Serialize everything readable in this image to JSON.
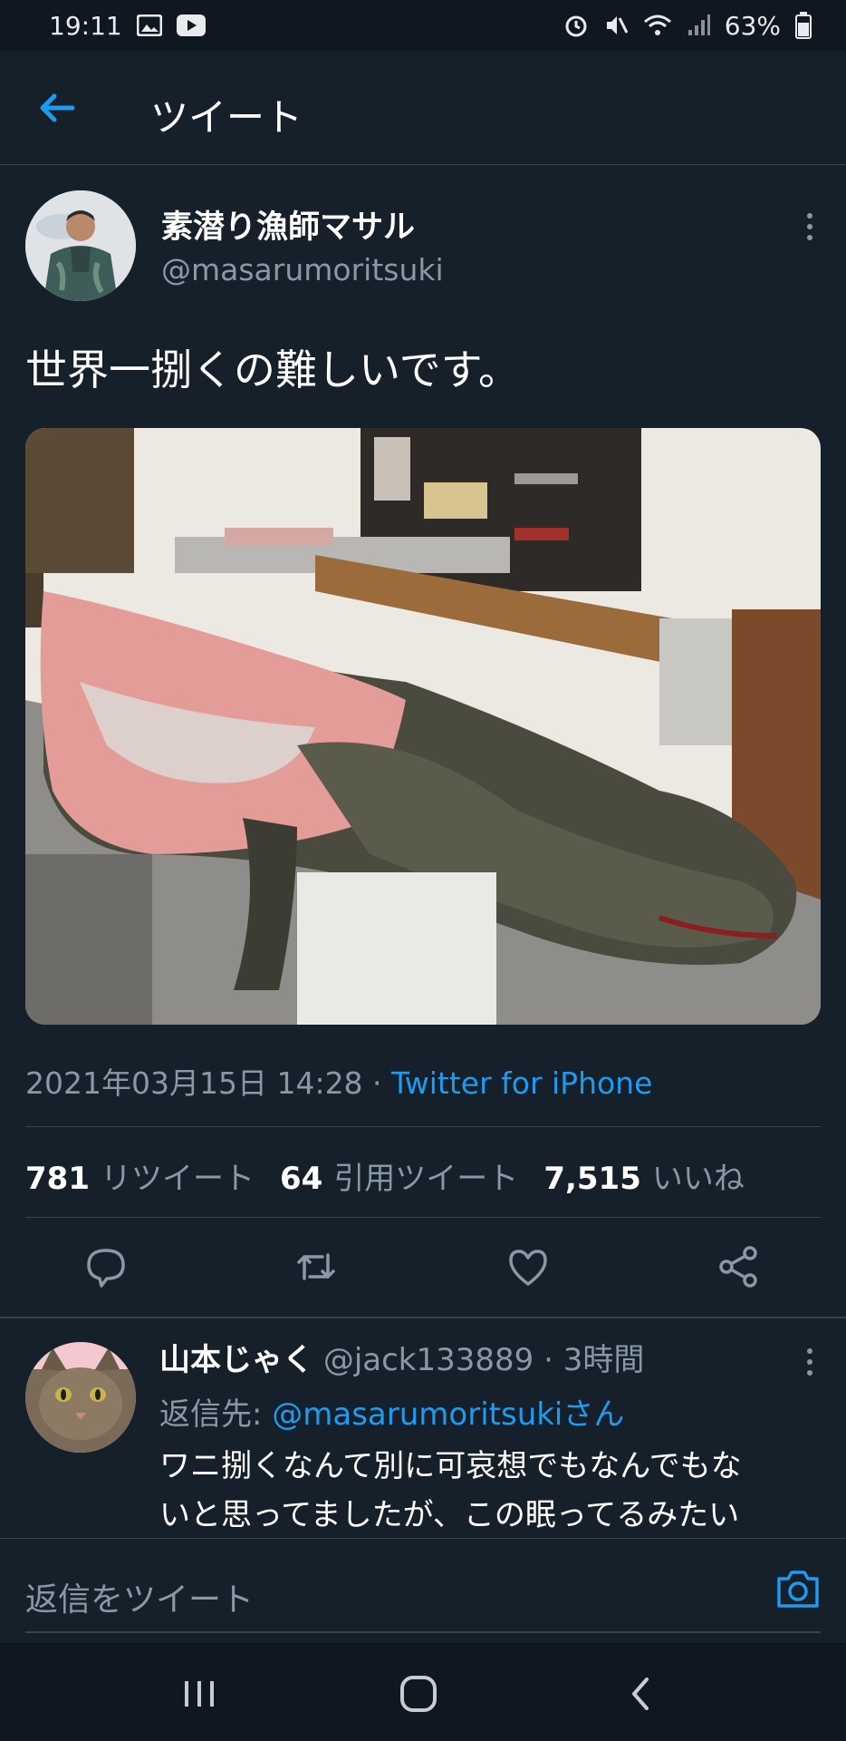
{
  "status_bar": {
    "time": "19:11",
    "battery": "63%",
    "icons": [
      "image-icon",
      "youtube-icon",
      "alarm-icon",
      "mute-icon",
      "wifi-icon",
      "signal-icon",
      "battery-icon"
    ]
  },
  "header": {
    "title": "ツイート",
    "back_icon": "back-arrow-icon"
  },
  "tweet": {
    "display_name": "素潜り漁師マサル",
    "handle": "@masarumoritsuki",
    "text": "世界一捌くの難しいです。",
    "date": "2021年03月15日 14:28",
    "separator": " · ",
    "source": "Twitter for iPhone",
    "stats": {
      "retweets_count": "781",
      "retweets_label": "リツイート",
      "quotes_count": "64",
      "quotes_label": "引用ツイート",
      "likes_count": "7,515",
      "likes_label": "いいね"
    },
    "actions": [
      "reply-icon",
      "retweet-icon",
      "like-icon",
      "share-icon"
    ]
  },
  "reply": {
    "display_name": "山本じゃく",
    "handle": "@jack133889",
    "time": " · 3時間",
    "reply_to_label": "返信先: ",
    "reply_to_handle": "@masarumoritsukiさん",
    "text_line1": "ワニ捌くなんて別に可哀想でもなんでもな",
    "text_line2": "いと思ってましたが、この眠ってるみたい"
  },
  "composer": {
    "placeholder": "返信をツイート"
  },
  "colors": {
    "background": "#15202b",
    "accent": "#1d9bf0",
    "secondary_text": "#8899a6",
    "divider": "#38444d"
  }
}
